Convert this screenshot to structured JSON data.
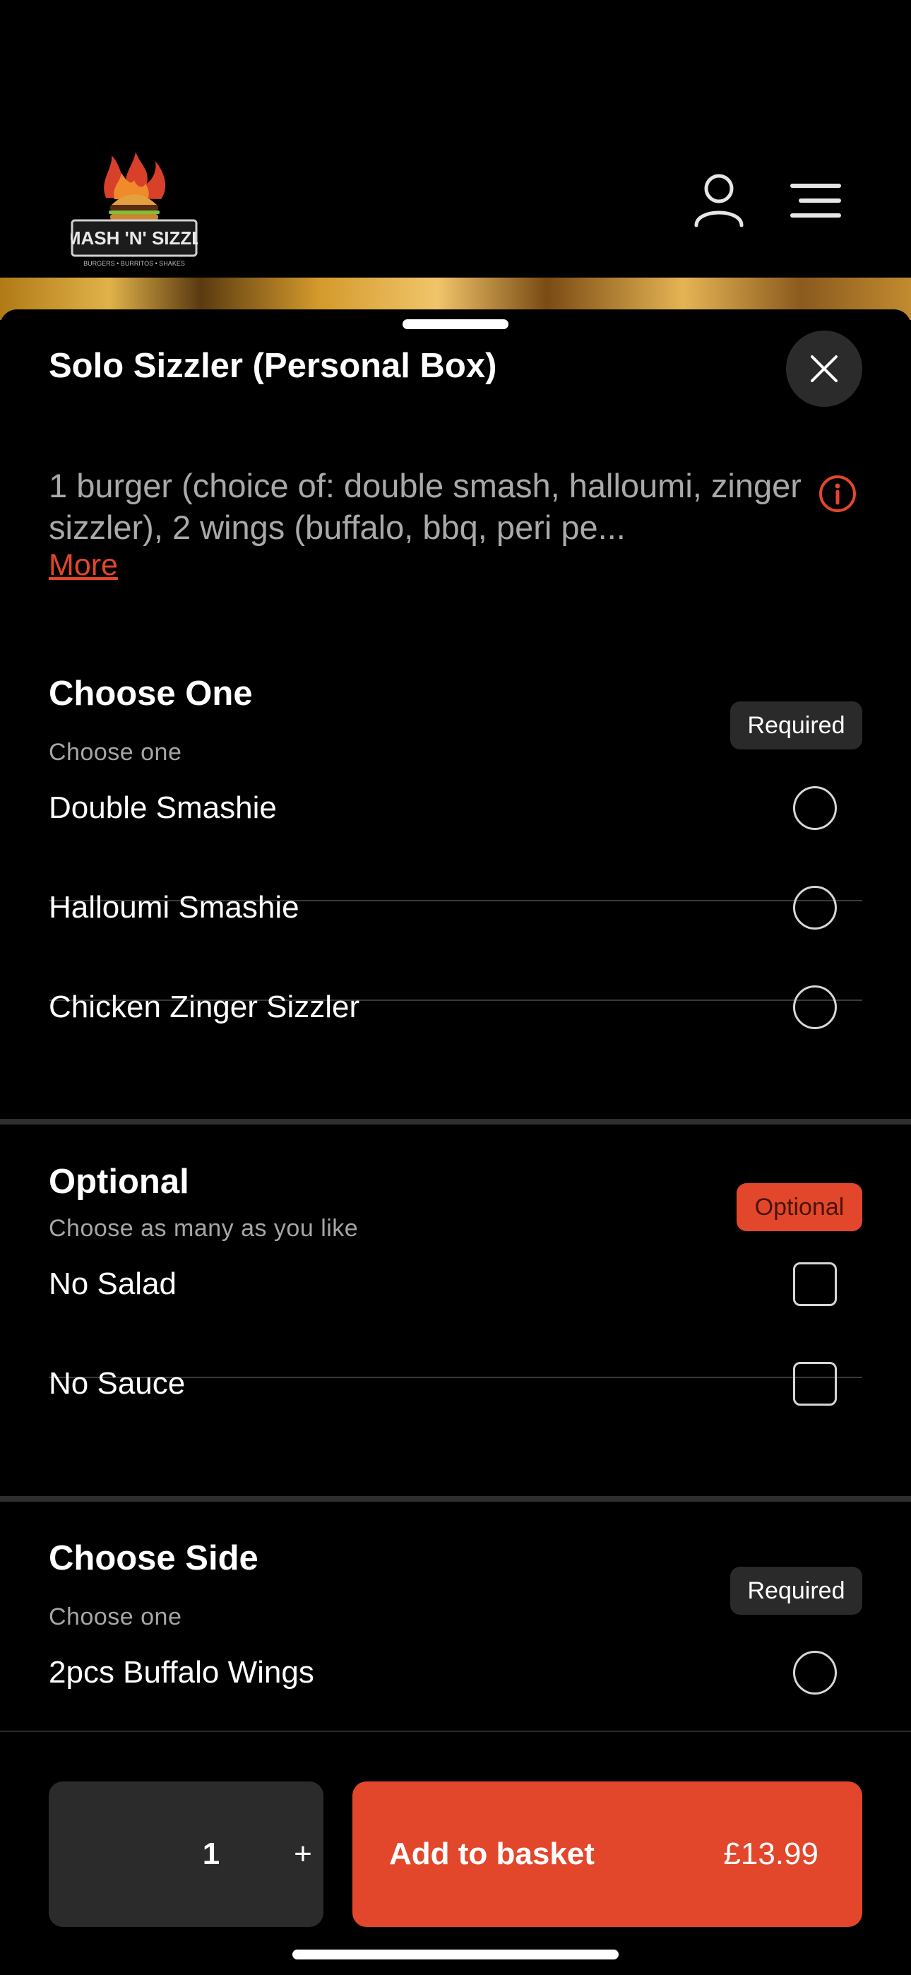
{
  "header": {
    "logo_text": "SMASH 'N' SIZZLE",
    "logo_tagline": "BURGERS • BURRITOS • SHAKES"
  },
  "product": {
    "title": "Solo Sizzler (Personal Box)",
    "description": "1 burger (choice of: double smash, halloumi, zinger sizzler), 2 wings (buffalo, bbq, peri pe...",
    "more_label": "More"
  },
  "sections": {
    "choose_one": {
      "title": "Choose One",
      "subtitle": "Choose one",
      "badge": "Required",
      "options": [
        "Double Smashie",
        "Halloumi Smashie",
        "Chicken Zinger Sizzler"
      ]
    },
    "optional": {
      "title": "Optional",
      "subtitle": "Choose as many as you like",
      "badge": "Optional",
      "options": [
        "No Salad",
        "No Sauce"
      ]
    },
    "choose_side": {
      "title": "Choose Side",
      "subtitle": "Choose one",
      "badge": "Required",
      "options": [
        "2pcs Buffalo Wings"
      ]
    }
  },
  "footer": {
    "quantity": "1",
    "plus_label": "+",
    "add_label": "Add to basket",
    "price": "£13.99"
  },
  "colors": {
    "accent": "#e2472b",
    "background": "#000000",
    "surface": "#2b2b2b"
  }
}
